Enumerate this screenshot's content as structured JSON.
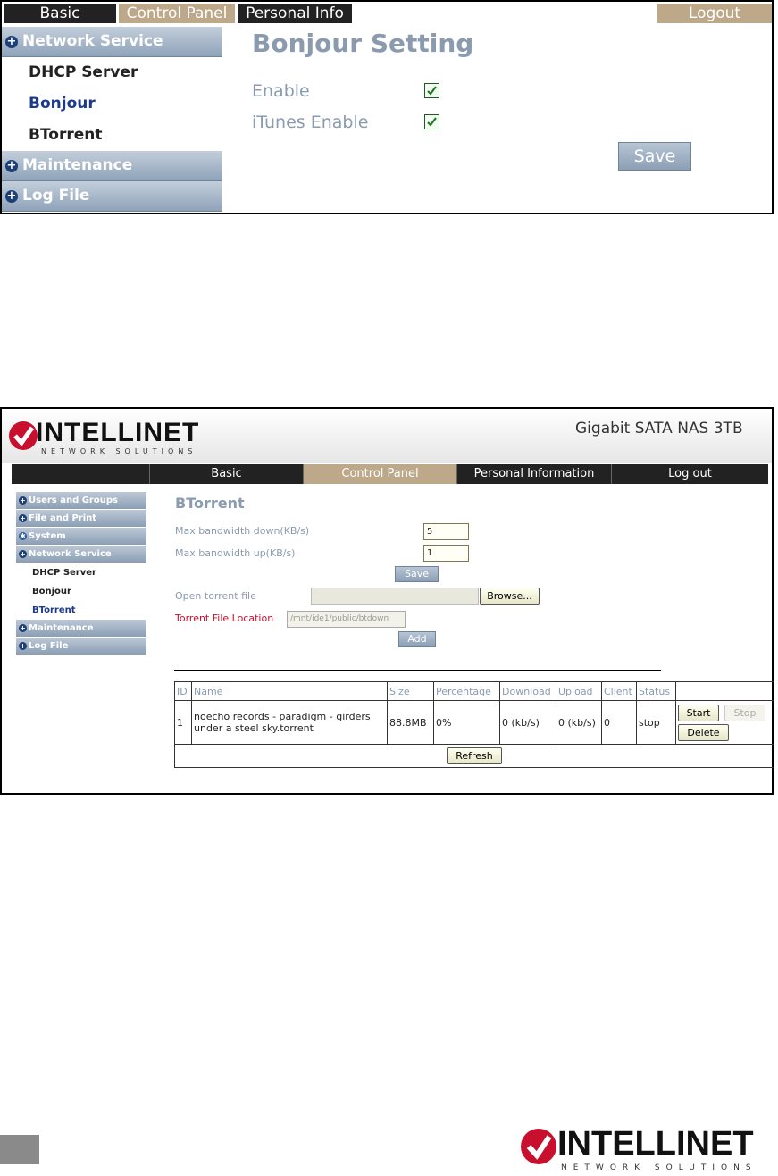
{
  "s1": {
    "tabs": [
      "Basic",
      "Control Panel",
      "Personal Info"
    ],
    "logout": "Logout",
    "sidebar": {
      "network_service": "Network Service",
      "items": [
        "DHCP Server",
        "Bonjour",
        "BTorrent"
      ],
      "maintenance": "Maintenance",
      "log_file": "Log File"
    },
    "title": "Bonjour Setting",
    "enable_label": "Enable",
    "enable_checked": true,
    "itunes_label": "iTunes Enable",
    "itunes_checked": true,
    "save": "Save"
  },
  "s2": {
    "brand": "INTELLINET",
    "brand_sub": "NETWORK SOLUTIONS",
    "product": "Gigabit SATA NAS 3TB",
    "nav": [
      "Basic",
      "Control Panel",
      "Personal Information",
      "Log out"
    ],
    "sidebar": {
      "cats": [
        "Users and Groups",
        "File and Print",
        "System",
        "Network Service"
      ],
      "subs": [
        "DHCP Server",
        "Bonjour",
        "BTorrent"
      ],
      "bottom": [
        "Maintenance",
        "Log File"
      ]
    },
    "title": "BTorrent",
    "max_down_label": "Max bandwidth down(KB/s)",
    "max_down_value": "5",
    "max_up_label": "Max bandwidth up(KB/s)",
    "max_up_value": "1",
    "save": "Save",
    "open_label": "Open torrent file",
    "browse": "Browse...",
    "location_label": "Torrent File Location",
    "location_value": "/mnt/ide1/public/btdown",
    "add": "Add",
    "table": {
      "headers": [
        "ID",
        "Name",
        "Size",
        "Percentage",
        "Download",
        "Upload",
        "Client",
        "Status",
        ""
      ],
      "row": {
        "id": "1",
        "name": "noecho records - paradigm - girders under a steel sky.torrent",
        "size": "88.8MB",
        "percentage": "0%",
        "download": "0 (kb/s)",
        "upload": "0 (kb/s)",
        "client": "0",
        "status": "stop"
      },
      "start": "Start",
      "stop": "Stop",
      "delete": "Delete",
      "refresh": "Refresh"
    }
  },
  "footer": {
    "brand": "INTELLINET",
    "brand_sub": "NETWORK SOLUTIONS"
  },
  "colors": {
    "accent_tan": "#bda88a",
    "dark_tab": "#222222",
    "side_blue": "#1c3f78",
    "title_grey": "#8a9bb0",
    "logo_red": "#c8102e"
  }
}
